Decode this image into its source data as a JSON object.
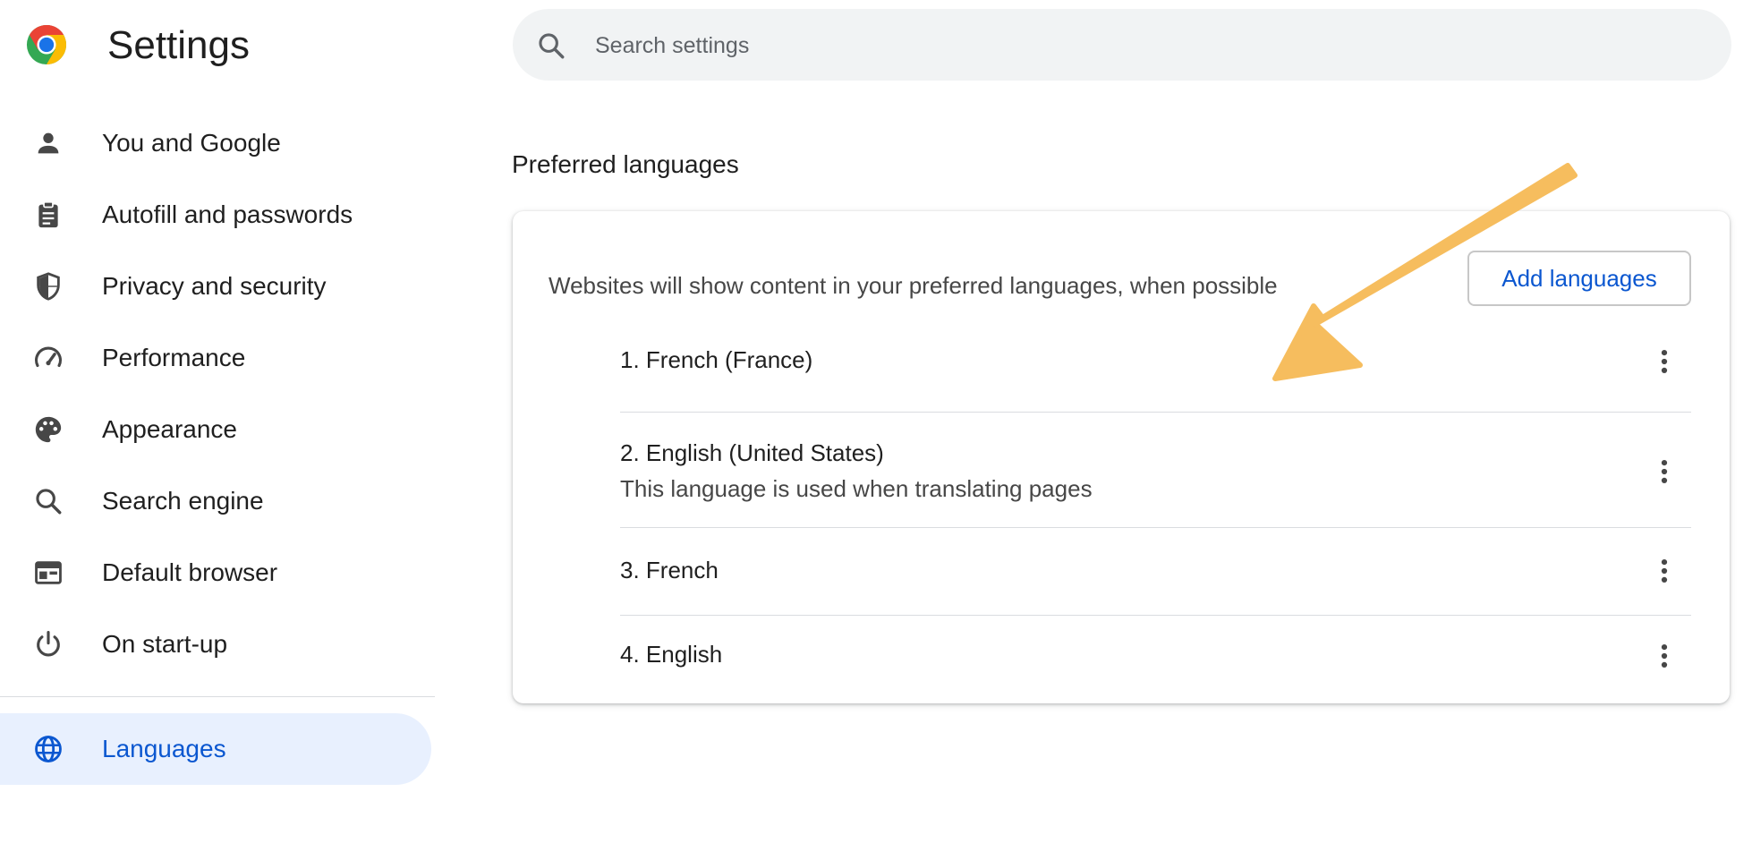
{
  "header": {
    "title": "Settings",
    "search_placeholder": "Search settings"
  },
  "sidebar": {
    "items": [
      {
        "label": "You and Google",
        "icon": "person-icon"
      },
      {
        "label": "Autofill and passwords",
        "icon": "clipboard-icon"
      },
      {
        "label": "Privacy and security",
        "icon": "shield-icon"
      },
      {
        "label": "Performance",
        "icon": "speedometer-icon"
      },
      {
        "label": "Appearance",
        "icon": "palette-icon"
      },
      {
        "label": "Search engine",
        "icon": "search-icon"
      },
      {
        "label": "Default browser",
        "icon": "browser-window-icon"
      },
      {
        "label": "On start-up",
        "icon": "power-icon"
      }
    ],
    "active": {
      "label": "Languages",
      "icon": "globe-icon"
    }
  },
  "main": {
    "section_title": "Preferred languages",
    "description": "Websites will show content in your preferred languages, when possible",
    "add_button_label": "Add languages",
    "languages": [
      {
        "name": "1. French (France)",
        "sub": ""
      },
      {
        "name": "2. English (United States)",
        "sub": "This language is used when translating pages"
      },
      {
        "name": "3. French",
        "sub": ""
      },
      {
        "name": "4. English",
        "sub": ""
      }
    ]
  },
  "colors": {
    "accent": "#0b57d0",
    "active_bg": "#e8f0fe",
    "search_bg": "#f1f3f4",
    "annotation_arrow": "#f6bd5e"
  }
}
